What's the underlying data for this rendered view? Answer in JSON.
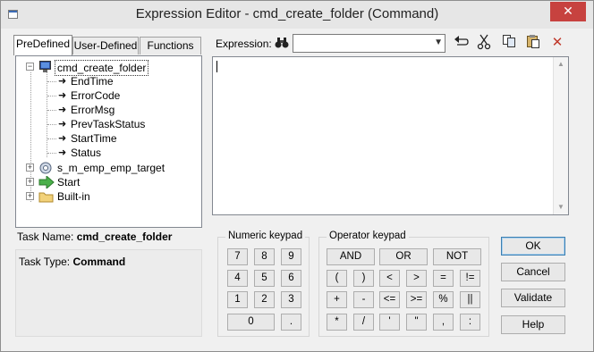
{
  "window": {
    "title": "Expression Editor - cmd_create_folder (Command)",
    "close_glyph": "✕"
  },
  "tabs": [
    {
      "label": "PreDefined"
    },
    {
      "label": "User-Defined"
    },
    {
      "label": "Functions"
    }
  ],
  "tree": {
    "root": "cmd_create_folder",
    "children": [
      "EndTime",
      "ErrorCode",
      "ErrorMsg",
      "PrevTaskStatus",
      "StartTime",
      "Status"
    ],
    "other_nodes": [
      "s_m_emp_emp_target",
      "Start",
      "Built-in"
    ]
  },
  "task": {
    "name_label": "Task Name:",
    "name_value": "cmd_create_folder",
    "type_label": "Task Type:",
    "type_value": "Command"
  },
  "expression": {
    "label": "Expression:",
    "value": "",
    "editor_text": ""
  },
  "toolbar_icons": [
    "binoculars-icon",
    "undo-icon",
    "cut-icon",
    "copy-icon",
    "paste-icon",
    "delete-icon"
  ],
  "numeric_keypad": {
    "title": "Numeric keypad",
    "keys": [
      "7",
      "8",
      "9",
      "4",
      "5",
      "6",
      "1",
      "2",
      "3",
      "0",
      "."
    ]
  },
  "operator_keypad": {
    "title": "Operator keypad",
    "row1": [
      "AND",
      "OR",
      "NOT"
    ],
    "row2": [
      "(",
      ")",
      "<",
      ">",
      "=",
      "!="
    ],
    "row3": [
      "+",
      "-",
      "<=",
      ">=",
      "%",
      "||"
    ],
    "row4": [
      "*",
      "/",
      "'",
      "\"",
      ",",
      ":"
    ]
  },
  "buttons": {
    "ok": "OK",
    "cancel": "Cancel",
    "validate": "Validate",
    "help": "Help"
  },
  "colors": {
    "close_button": "#c7423f",
    "delete_icon": "#c0392b",
    "default_button_border": "#3c7fb1"
  }
}
